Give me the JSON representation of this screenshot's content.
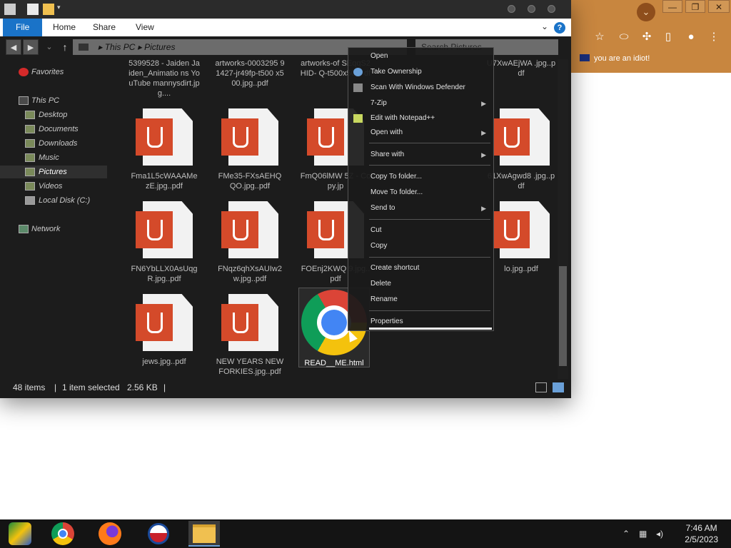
{
  "browser": {
    "bookmark": "you are an idiot!",
    "min": "—",
    "max": "❐",
    "close": "✕"
  },
  "explorer": {
    "ribbon": {
      "file": "File",
      "home": "Home",
      "share": "Share",
      "view": "View"
    },
    "address": {
      "this_pc": "This PC",
      "sep": "▸",
      "pictures": "Pictures"
    },
    "search_placeholder": "Search Pictures",
    "sidebar": [
      {
        "label": "Favorites",
        "icon": "heart-icon"
      },
      {
        "label": "This PC",
        "icon": "pc-icon"
      },
      {
        "label": "Desktop",
        "icon": "desktop-icon"
      },
      {
        "label": "Documents",
        "icon": "documents-icon"
      },
      {
        "label": "Downloads",
        "icon": "downloads-icon"
      },
      {
        "label": "Music",
        "icon": "music-icon"
      },
      {
        "label": "Pictures",
        "icon": "pictures-icon"
      },
      {
        "label": "Videos",
        "icon": "videos-icon"
      },
      {
        "label": "Local Disk (C:)",
        "icon": "disk-icon"
      },
      {
        "label": "Network",
        "icon": "network-icon"
      }
    ],
    "files": [
      {
        "name": "5399528 - Jaiden Jaiden_Animatio ns YouTube mannysdirt.jpg...."
      },
      {
        "name": "artworks-0003295 91427-jr49fp-t500 x500.jpg..pdf"
      },
      {
        "name": "artworks-of SEqqS2HID- Q-t500x500. df"
      },
      {
        "name": "U7XwAEjWA .jpg..pdf"
      },
      {
        "name": "Fma1L5cWAAAMe zE.jpg..pdf"
      },
      {
        "name": "FMe35-FXsAEHQ QO.jpg..pdf"
      },
      {
        "name": "FmQ06lMW 5Z - Copy.jp"
      },
      {
        "name": "61XwAgwd8 .jpg..pdf"
      },
      {
        "name": "FN6YbLLX0AsUqg R.jpg..pdf"
      },
      {
        "name": "FNqz6qhXsAUIw2 w.jpg..pdf"
      },
      {
        "name": "FOEnj2KWQ 9.jpg..pdf"
      },
      {
        "name": "lo.jpg..pdf"
      },
      {
        "name": "jews.jpg..pdf"
      },
      {
        "name": "NEW YEARS NEW FORKIES.jpg..pdf"
      },
      {
        "name": "READ__ME.html"
      }
    ],
    "status": {
      "count": "48 items",
      "selected": "1 item selected",
      "size": "2.56 KB",
      "sep": "|"
    }
  },
  "context_menu": [
    {
      "label": "Open"
    },
    {
      "label": "Take Ownership"
    },
    {
      "label": "Scan With Windows Defender"
    },
    {
      "label": "7-Zip"
    },
    {
      "label": "Edit with Notepad++"
    },
    {
      "label": "Open with"
    },
    {
      "label": "Share with"
    },
    {
      "label": "Copy To folder..."
    },
    {
      "label": "Move To folder..."
    },
    {
      "label": "Send to"
    },
    {
      "label": "Cut"
    },
    {
      "label": "Copy"
    },
    {
      "label": "Create shortcut"
    },
    {
      "label": "Delete"
    },
    {
      "label": "Rename"
    },
    {
      "label": "Properties"
    }
  ],
  "taskbar": {
    "time": "7:46 AM",
    "date": "2/5/2023",
    "apps": [
      "start-icon",
      "chrome-icon",
      "firefox-icon",
      "obama-icon",
      "file-explorer-icon"
    ]
  }
}
